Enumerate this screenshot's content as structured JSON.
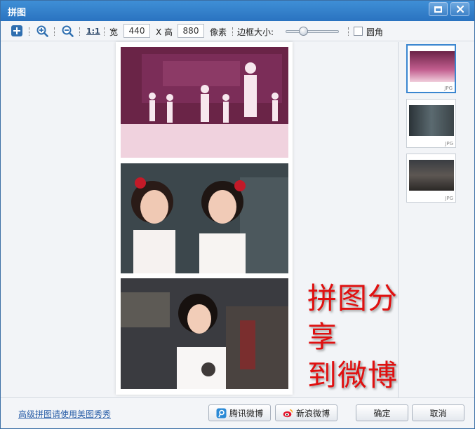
{
  "window": {
    "title": "拼图"
  },
  "toolbar": {
    "one_to_one": "1:1",
    "width_label": "宽",
    "width_value": "440",
    "height_label": "X 高",
    "height_value": "880",
    "unit_label": "像素",
    "border_label": "边框大小:",
    "border_level": 0.3,
    "rounded_label": "圆角",
    "rounded_checked": false
  },
  "canvas": {
    "overlay_line1": "拼图分享",
    "overlay_line2": "到微博"
  },
  "sidebar": {
    "thumbnails": [
      {
        "tag": "JPG"
      },
      {
        "tag": "JPG"
      },
      {
        "tag": "JPG"
      }
    ]
  },
  "bottom": {
    "advanced_link": "高级拼图请使用美图秀秀",
    "tencent_button": "腾讯微博",
    "sina_button": "新浪微博",
    "ok_button": "确定",
    "cancel_button": "取消"
  },
  "colors": {
    "titlebar": "#2a73c0",
    "overlay_text": "#e01010",
    "link": "#2a5fa8"
  }
}
